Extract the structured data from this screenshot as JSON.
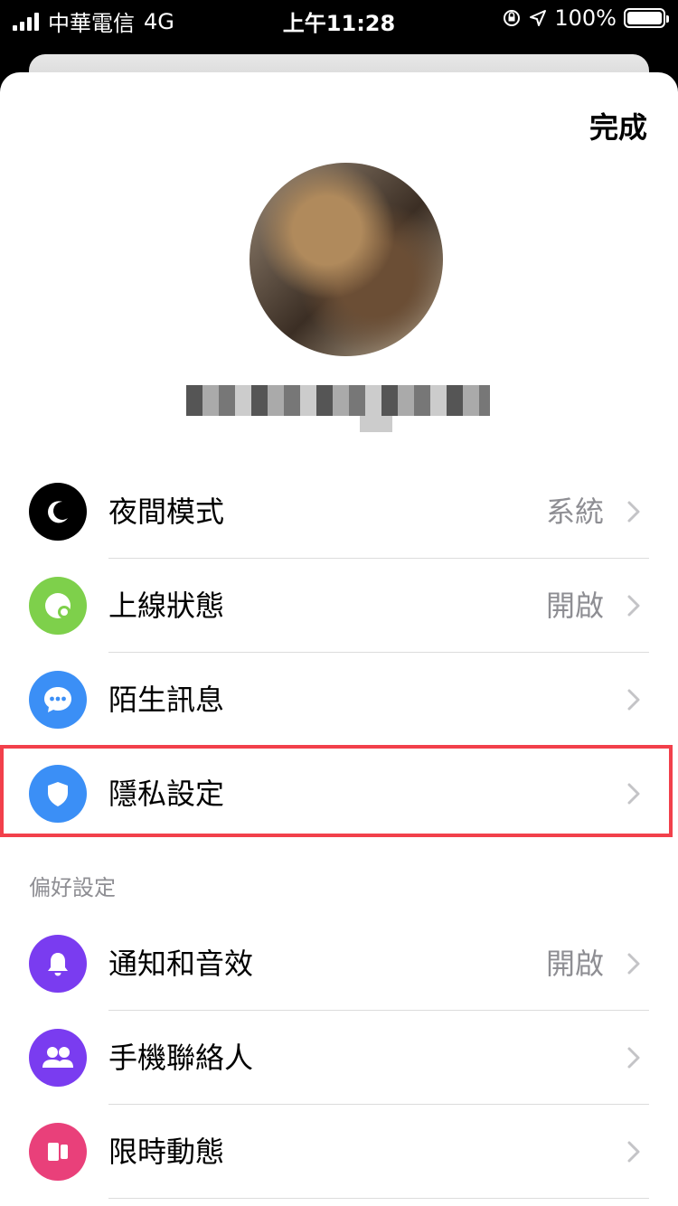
{
  "status_bar": {
    "carrier": "中華電信",
    "network": "4G",
    "time": "上午11:28",
    "battery": "100%"
  },
  "header": {
    "done_label": "完成"
  },
  "profile": {
    "name": ""
  },
  "settings": [
    {
      "label": "夜間模式",
      "value": "系統",
      "icon": "moon-icon",
      "color": "#000000"
    },
    {
      "label": "上線狀態",
      "value": "開啟",
      "icon": "active-status-icon",
      "color": "#7ed04b"
    },
    {
      "label": "陌生訊息",
      "value": "",
      "icon": "chat-bubble-icon",
      "color": "#3b8ff6"
    },
    {
      "label": "隱私設定",
      "value": "",
      "icon": "shield-icon",
      "color": "#3b8ff6"
    }
  ],
  "preferences_header": "偏好設定",
  "preferences": [
    {
      "label": "通知和音效",
      "value": "開啟",
      "icon": "bell-icon",
      "color": "#7a3cf0"
    },
    {
      "label": "手機聯絡人",
      "value": "",
      "icon": "people-icon",
      "color": "#7a3cf0"
    },
    {
      "label": "限時動態",
      "value": "",
      "icon": "story-icon",
      "color": "#e9407a"
    }
  ],
  "highlight_color": "#f2404b"
}
